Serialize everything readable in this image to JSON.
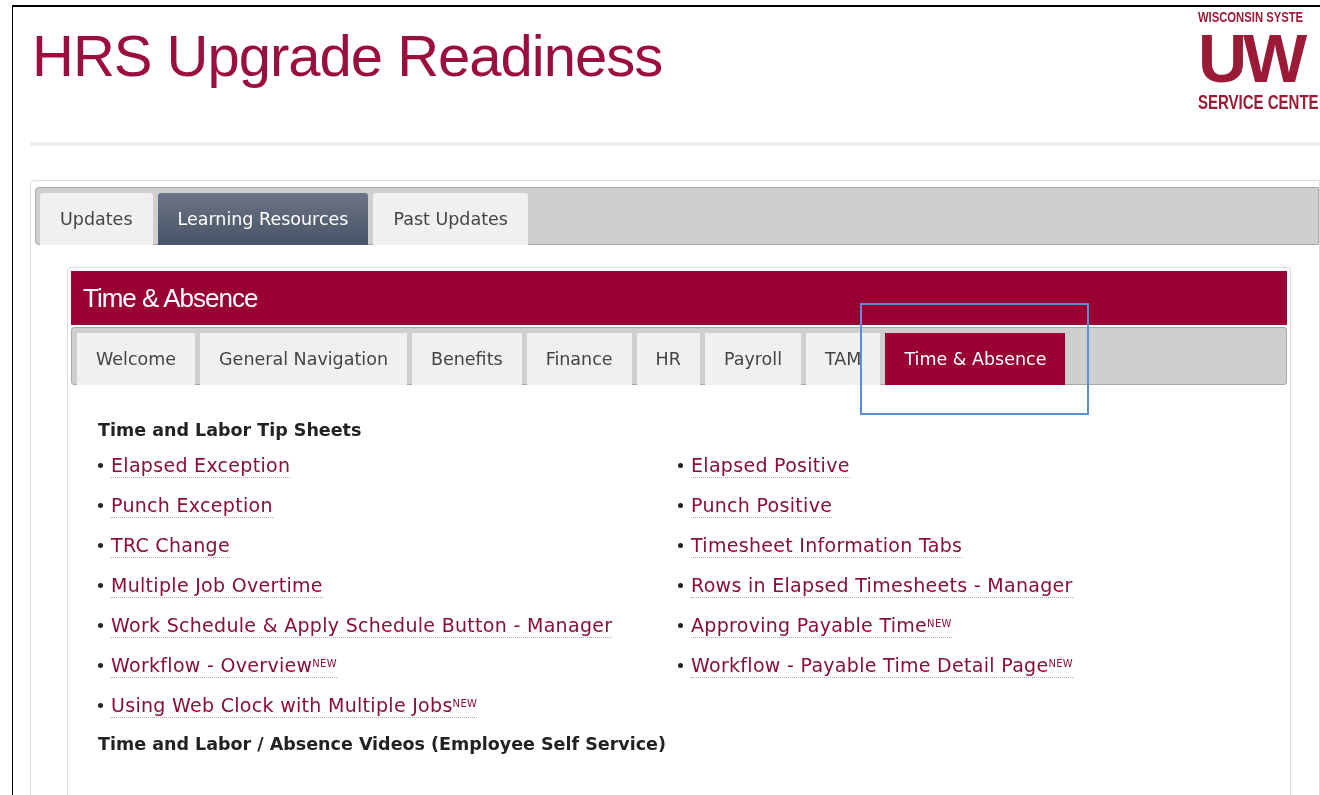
{
  "page_title": "HRS Upgrade Readiness",
  "logo": {
    "top": "WISCONSIN SYSTE",
    "mark": "UW",
    "bottom": "SERVICE CENTE"
  },
  "main_tabs": [
    {
      "label": "Updates",
      "selected": false
    },
    {
      "label": "Learning Resources",
      "selected": true
    },
    {
      "label": "Past Updates",
      "selected": false
    }
  ],
  "panel": {
    "title": "Time & Absence",
    "tabs": [
      {
        "label": "Welcome",
        "selected": false,
        "highlighted": false
      },
      {
        "label": "General Navigation",
        "selected": false,
        "highlighted": false
      },
      {
        "label": "Benefits",
        "selected": false,
        "highlighted": false
      },
      {
        "label": "Finance",
        "selected": false,
        "highlighted": false
      },
      {
        "label": "HR",
        "selected": false,
        "highlighted": false
      },
      {
        "label": "Payroll",
        "selected": false,
        "highlighted": false
      },
      {
        "label": "TAM",
        "selected": false,
        "highlighted": false
      },
      {
        "label": "Time & Absence",
        "selected": true,
        "highlighted": true
      }
    ],
    "sections": [
      {
        "heading": "Time and Labor Tip Sheets",
        "links": [
          [
            "Elapsed Exception",
            "Elapsed Positive"
          ],
          [
            "Punch Exception",
            "Punch Positive"
          ],
          [
            "TRC Change",
            "Timesheet Information Tabs"
          ],
          [
            "Multiple Job Overtime",
            "Rows in Elapsed Timesheets - Manager"
          ],
          [
            "Work Schedule & Apply Schedule Button - Manager",
            "Approving Payable Time$^{NEW}$"
          ],
          [
            "Workflow - Overview$^{NEW}$",
            "Workflow - Payable Time Detail Page$^{NEW}$"
          ],
          [
            "Using Web Clock with Multiple Jobs$^{NEW}$"
          ]
        ]
      },
      {
        "heading": "Time and Labor / Absence Videos (Employee Self Service)"
      }
    ]
  }
}
